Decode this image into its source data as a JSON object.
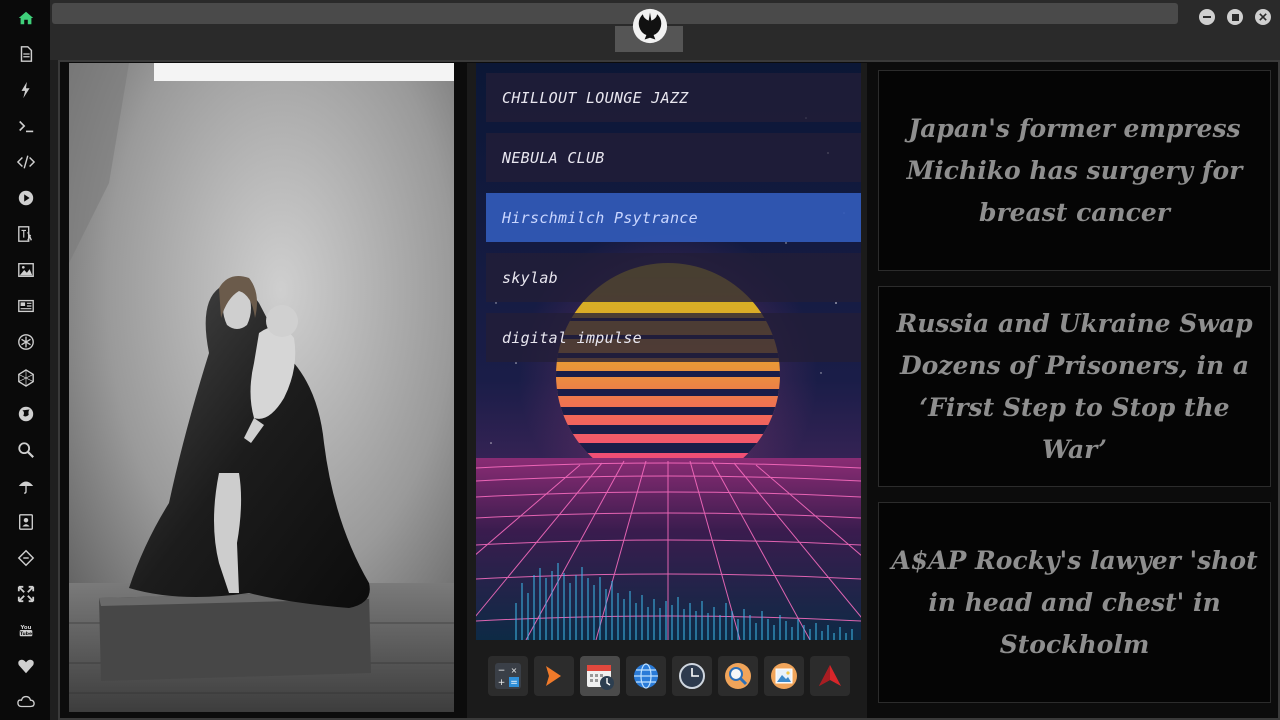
{
  "sidebar": {
    "items": [
      {
        "name": "home-icon",
        "glyph": "⌂"
      },
      {
        "name": "document-icon",
        "glyph": ""
      },
      {
        "name": "lightning-icon",
        "glyph": "ϟ"
      },
      {
        "name": "terminal-icon",
        "glyph": ">_"
      },
      {
        "name": "code-icon",
        "glyph": "</>"
      },
      {
        "name": "play-icon",
        "glyph": "▶"
      },
      {
        "name": "translate-icon",
        "glyph": "文A"
      },
      {
        "name": "image-icon",
        "glyph": ""
      },
      {
        "name": "newspaper-icon",
        "glyph": ""
      },
      {
        "name": "rebel-alliance-icon",
        "glyph": "✱"
      },
      {
        "name": "hexagon-icon",
        "glyph": "⬡"
      },
      {
        "name": "globe-icon",
        "glyph": "◉"
      },
      {
        "name": "search-icon",
        "glyph": "⚲"
      },
      {
        "name": "umbrella-icon",
        "glyph": "☂"
      },
      {
        "name": "contacts-icon",
        "glyph": ""
      },
      {
        "name": "code-fork-icon",
        "glyph": "◇"
      },
      {
        "name": "fullscreen-icon",
        "glyph": "✥"
      },
      {
        "name": "youtube-icon",
        "glyph": "You Tube"
      },
      {
        "name": "heart-icon",
        "glyph": "♥"
      },
      {
        "name": "cloud-icon",
        "glyph": "☁"
      }
    ]
  },
  "music": {
    "stations": [
      "CHILLOUT LOUNGE JAZZ",
      "NEBULA CLUB",
      "Hirschmilch Psytrance",
      "skylab",
      "digital impulse"
    ],
    "selected_index": 2
  },
  "dock": {
    "apps": [
      "calculator-icon",
      "terminal-app-icon",
      "calendar-icon",
      "web-browser-icon",
      "clock-icon",
      "search-app-icon",
      "image-viewer-icon",
      "rocket-icon"
    ]
  },
  "news": [
    {
      "headline": "Japan's former empress Michiko has surgery for breast cancer"
    },
    {
      "headline": "Russia and Ukraine Swap Dozens of Prisoners, in a ‘First Step to Stop the War’"
    },
    {
      "headline": "A$AP Rocky's lawyer 'shot in head and chest' in Stockholm"
    }
  ],
  "colors": {
    "accent": "#3fd07a",
    "selected_station": "#3a62b8",
    "headline_text": "#8e8e8e"
  }
}
